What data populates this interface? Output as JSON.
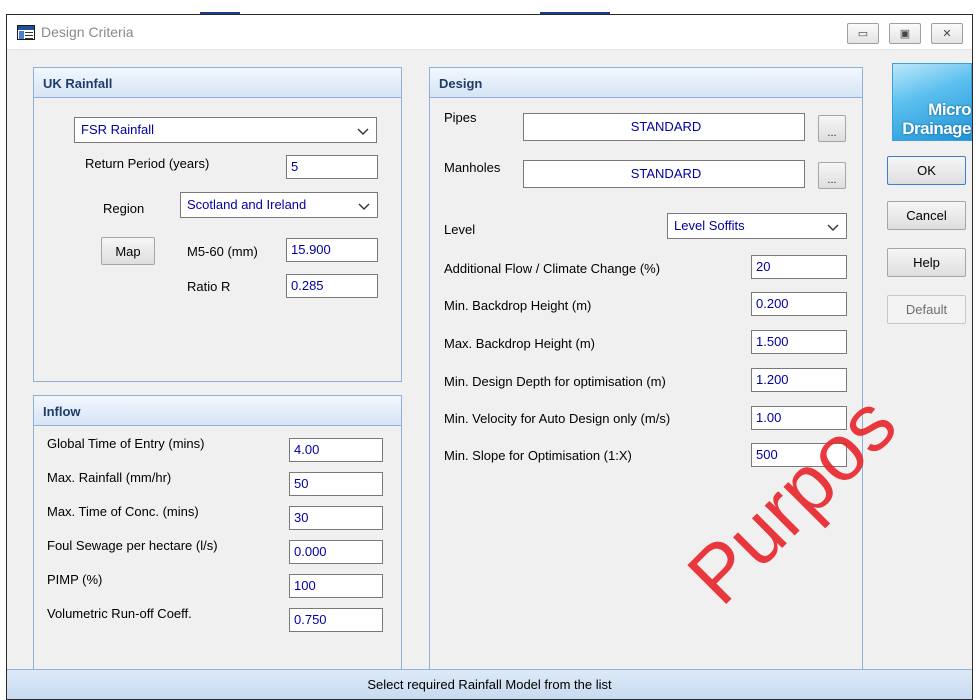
{
  "window": {
    "title": "Design Criteria",
    "controls": {
      "minimize": "▭",
      "maximize": "▣",
      "close": "✕"
    }
  },
  "rainfall": {
    "header": "UK Rainfall",
    "model": "FSR Rainfall",
    "return_period_label": "Return Period (years)",
    "return_period": "5",
    "region_label": "Region",
    "region": "Scotland and Ireland",
    "map_button": "Map",
    "m560_label": "M5-60 (mm)",
    "m560": "15.900",
    "ratio_label": "Ratio R",
    "ratio": "0.285"
  },
  "inflow": {
    "header": "Inflow",
    "rows": [
      {
        "label": "Global Time of Entry (mins)",
        "value": "4.00"
      },
      {
        "label": "Max. Rainfall (mm/hr)",
        "value": "50"
      },
      {
        "label": "Max. Time of Conc. (mins)",
        "value": "30"
      },
      {
        "label": "Foul Sewage per hectare (l/s)",
        "value": "0.000"
      },
      {
        "label": "PIMP (%)",
        "value": "100"
      },
      {
        "label": "Volumetric Run-off Coeff.",
        "value": "0.750"
      }
    ]
  },
  "design": {
    "header": "Design",
    "pipes_label": "Pipes",
    "pipes": "STANDARD",
    "manholes_label": "Manholes",
    "manholes": "STANDARD",
    "browse": "...",
    "level_label": "Level",
    "level": "Level Soffits",
    "rows": [
      {
        "label": "Additional Flow / Climate Change (%)",
        "value": "20"
      },
      {
        "label": "Min. Backdrop Height (m)",
        "value": "0.200"
      },
      {
        "label": "Max. Backdrop Height (m)",
        "value": "1.500"
      },
      {
        "label": "Min. Design Depth for optimisation (m)",
        "value": "1.200"
      },
      {
        "label": "Min. Velocity for Auto Design only (m/s)",
        "value": "1.00"
      },
      {
        "label": "Min. Slope for Optimisation (1:X)",
        "value": "500"
      }
    ]
  },
  "logo": {
    "line1": "Micro",
    "line2": "Drainage"
  },
  "buttons": {
    "ok": "OK",
    "cancel": "Cancel",
    "help": "Help",
    "default": "Default"
  },
  "status": "Select required Rainfall Model from the list",
  "watermark": "Purpos",
  "colors": {
    "field_text": "#0000a0",
    "group_border": "#8fb0d8",
    "watermark": "#e8242a"
  }
}
